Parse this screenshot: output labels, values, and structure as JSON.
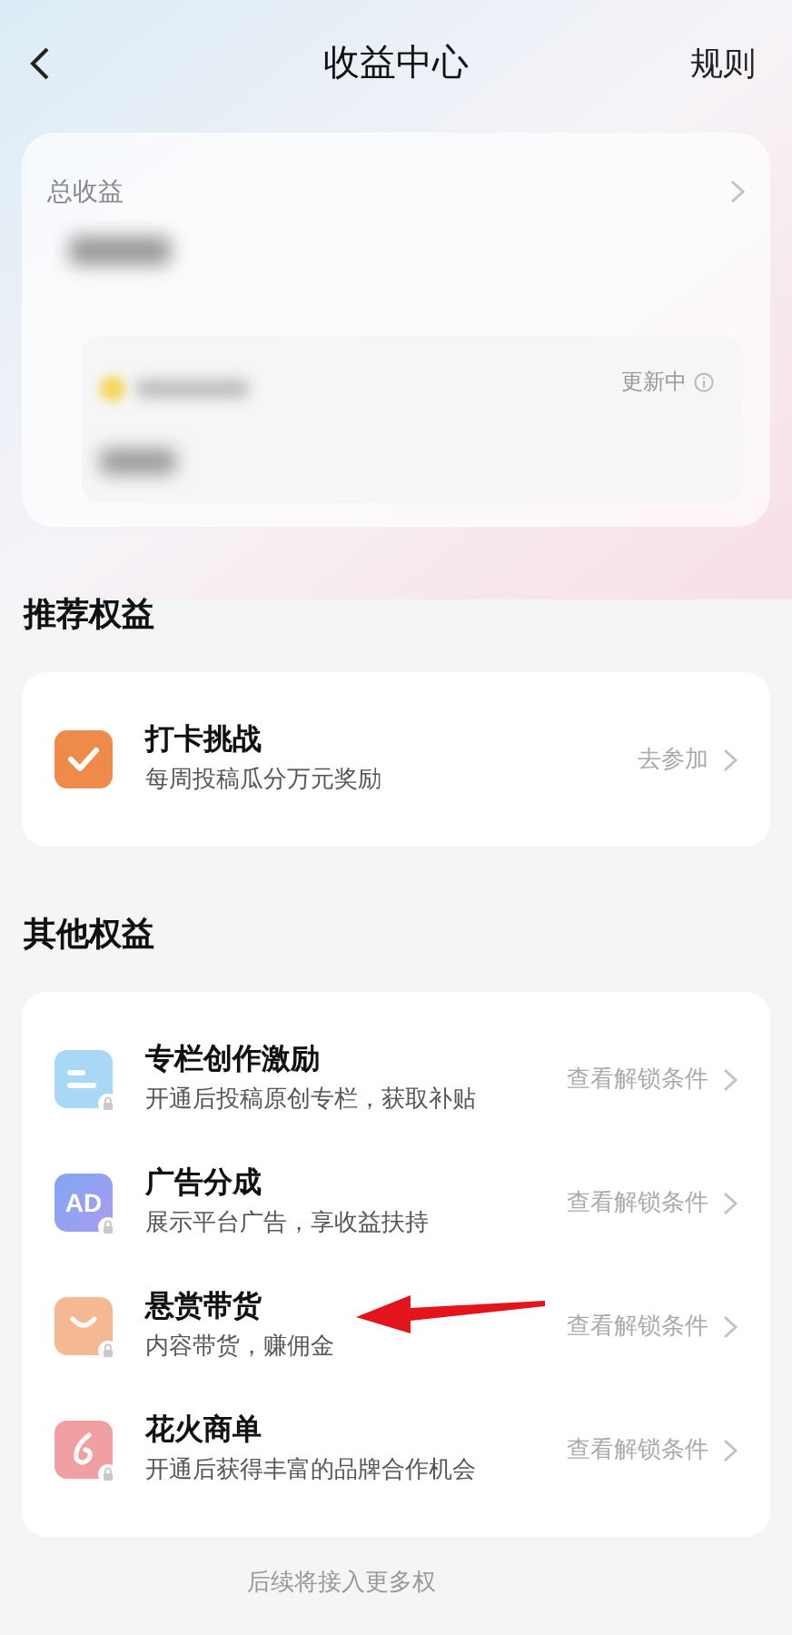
{
  "header": {
    "title": "收益中心",
    "action": "规则"
  },
  "earnings": {
    "label": "总收益",
    "status": "更新中"
  },
  "recommended": {
    "heading": "推荐权益",
    "items": [
      {
        "kind": "checkin",
        "title": "打卡挑战",
        "subtitle": "每周投稿瓜分万元奖励",
        "action": "去参加"
      }
    ]
  },
  "other": {
    "heading": "其他权益",
    "items": [
      {
        "kind": "column",
        "title": "专栏创作激励",
        "subtitle": "开通后投稿原创专栏，获取补贴",
        "action": "查看解锁条件",
        "locked": true
      },
      {
        "kind": "ad",
        "title": "广告分成",
        "subtitle": "展示平台广告，享收益扶持",
        "action": "查看解锁条件",
        "locked": true,
        "icon_text": "AD"
      },
      {
        "kind": "goods",
        "title": "悬赏带货",
        "subtitle": "内容带货，赚佣金",
        "action": "查看解锁条件",
        "locked": true
      },
      {
        "kind": "spark",
        "title": "花火商单",
        "subtitle": "开通后获得丰富的品牌合作机会",
        "action": "查看解锁条件",
        "locked": true
      }
    ]
  },
  "footer": "后续将接入更多权"
}
